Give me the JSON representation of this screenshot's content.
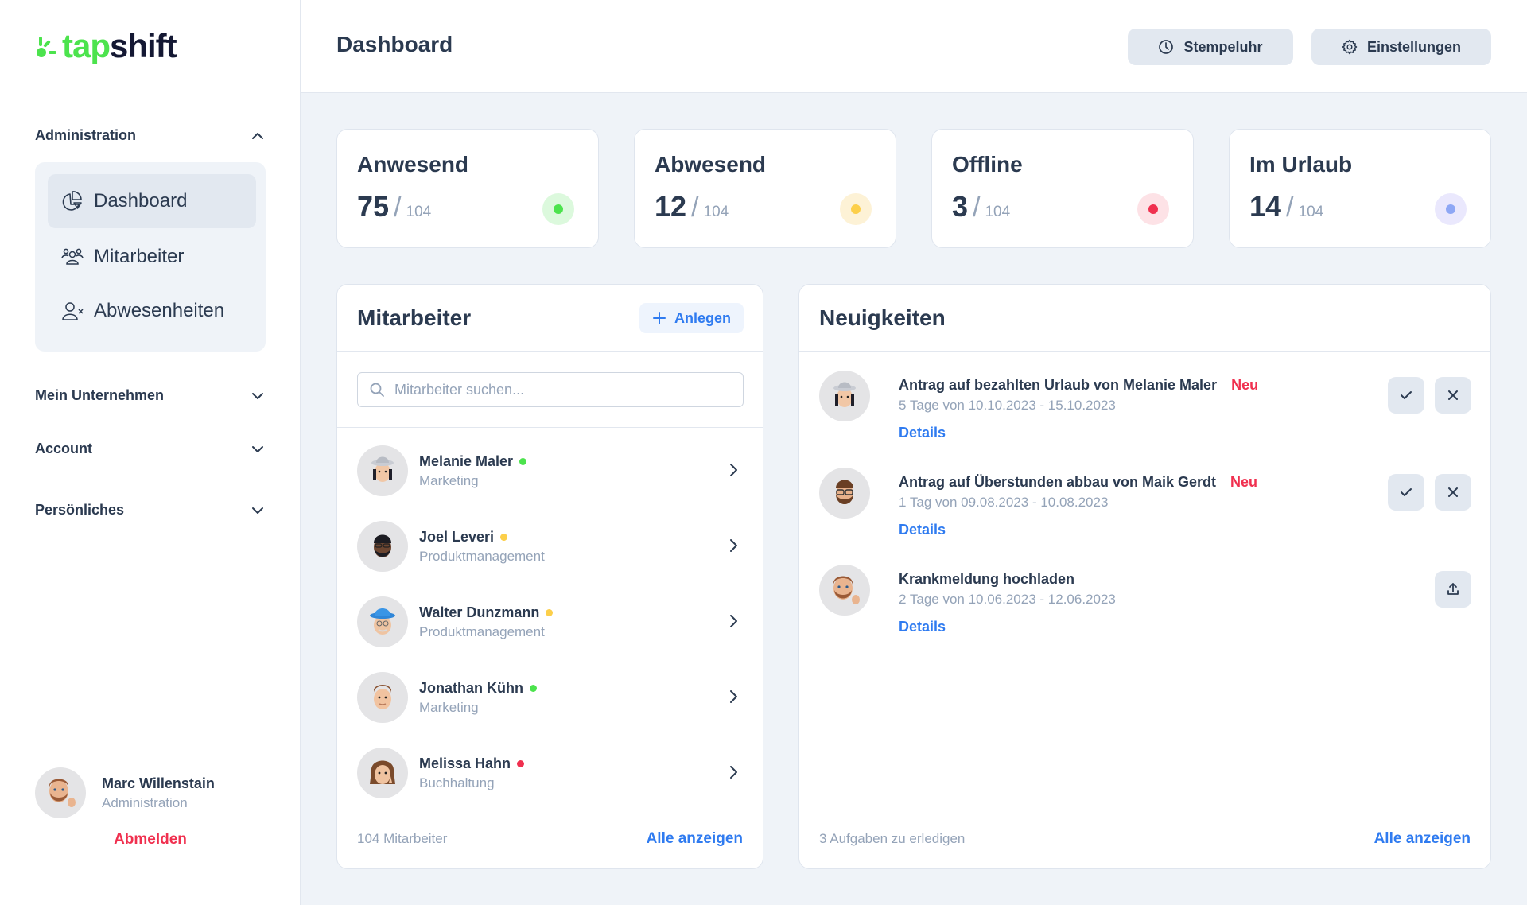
{
  "brand": {
    "part1": "tap",
    "part2": "shift",
    "accent": "#4ce34d",
    "dark": "#141833"
  },
  "sidebar": {
    "groups": [
      {
        "label": "Administration",
        "expanded": true,
        "items": [
          {
            "label": "Dashboard",
            "icon": "pie-chart-icon",
            "active": true
          },
          {
            "label": "Mitarbeiter",
            "icon": "users-icon",
            "active": false
          },
          {
            "label": "Abwesenheiten",
            "icon": "user-x-icon",
            "active": false
          }
        ]
      },
      {
        "label": "Mein Unternehmen",
        "expanded": false
      },
      {
        "label": "Account",
        "expanded": false
      },
      {
        "label": "Persönliches",
        "expanded": false
      }
    ],
    "user": {
      "name": "Marc Willenstain",
      "role": "Administration"
    },
    "logout_label": "Abmelden"
  },
  "header": {
    "title": "Dashboard",
    "buttons": [
      {
        "label": "Stempeluhr",
        "icon": "clock-icon"
      },
      {
        "label": "Einstellungen",
        "icon": "gear-icon"
      }
    ]
  },
  "stats": [
    {
      "label": "Anwesend",
      "value": "75",
      "total": "104",
      "color": "#4ce34d",
      "bg": "#dcf9dd"
    },
    {
      "label": "Abwesend",
      "value": "12",
      "total": "104",
      "color": "#fccf4a",
      "bg": "#fdf2d6"
    },
    {
      "label": "Offline",
      "value": "3",
      "total": "104",
      "color": "#f0304f",
      "bg": "#fde2e6"
    },
    {
      "label": "Im Urlaub",
      "value": "14",
      "total": "104",
      "color": "#8ea7f5",
      "bg": "#eae8fd"
    }
  ],
  "employees_panel": {
    "title": "Mitarbeiter",
    "add_label": "Anlegen",
    "search_placeholder": "Mitarbeiter suchen...",
    "search_value": "",
    "employees": [
      {
        "name": "Melanie Maler",
        "dept": "Marketing",
        "status": "anwesend",
        "status_color": "#4ce34d"
      },
      {
        "name": "Joel Leveri",
        "dept": "Produktmanagement",
        "status": "abwesend",
        "status_color": "#fccf4a"
      },
      {
        "name": "Walter Dunzmann",
        "dept": "Produktmanagement",
        "status": "abwesend",
        "status_color": "#fccf4a"
      },
      {
        "name": "Jonathan Kühn",
        "dept": "Marketing",
        "status": "anwesend",
        "status_color": "#4ce34d"
      },
      {
        "name": "Melissa Hahn",
        "dept": "Buchhaltung",
        "status": "offline",
        "status_color": "#f0304f"
      }
    ],
    "footer_count": "104 Mitarbeiter",
    "footer_link": "Alle anzeigen"
  },
  "news_panel": {
    "title": "Neuigkeiten",
    "items": [
      {
        "title": "Antrag auf bezahlten Urlaub von Melanie Maler",
        "badge": "Neu",
        "subtitle": "5 Tage von 10.10.2023 - 15.10.2023",
        "link": "Details",
        "actions": [
          "approve",
          "reject"
        ]
      },
      {
        "title": "Antrag auf Überstunden abbau von Maik Gerdt",
        "badge": "Neu",
        "subtitle": "1 Tag von 09.08.2023 - 10.08.2023",
        "link": "Details",
        "actions": [
          "approve",
          "reject"
        ]
      },
      {
        "title": "Krankmeldung hochladen",
        "badge": "",
        "subtitle": "2 Tage von 10.06.2023 - 12.06.2023",
        "link": "Details",
        "actions": [
          "upload"
        ]
      }
    ],
    "footer_count": "3 Aufgaben zu erledigen",
    "footer_link": "Alle anzeigen"
  }
}
